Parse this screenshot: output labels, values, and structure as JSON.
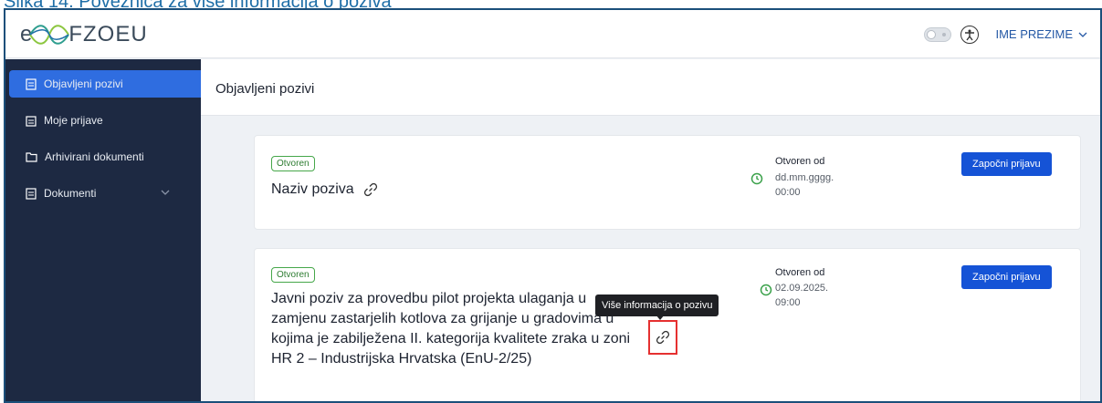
{
  "caption": "Slika 14. Poveznica za više informacija o poziva",
  "header": {
    "logo_prefix": "e",
    "logo_text": "FZOEU",
    "user_name": "IME PREZIME"
  },
  "sidebar": {
    "items": [
      {
        "label": "Objavljeni pozivi",
        "icon": "document-icon",
        "active": true
      },
      {
        "label": "Moje prijave",
        "icon": "clipboard-icon",
        "active": false
      },
      {
        "label": "Arhivirani dokumenti",
        "icon": "folder-icon",
        "active": false
      },
      {
        "label": "Dokumenti",
        "icon": "document-icon",
        "active": false
      }
    ]
  },
  "main": {
    "title": "Objavljeni pozivi",
    "cards": [
      {
        "status": "Otvoren",
        "title": "Naziv poziva",
        "open_label": "Otvoren od",
        "open_date": "dd.mm.gggg.",
        "open_time": "00:00",
        "button": "Započni prijavu"
      },
      {
        "status": "Otvoren",
        "title_lines": [
          "Javni poziv za provedbu pilot projekta ulaganja u",
          "zamjenu zastarjelih kotlova za grijanje u gradovima u",
          "kojima je zabilježena II. kategorija kvalitete zraka u zoni",
          "HR 2 – Industrijska Hrvatska (EnU-2/25)"
        ],
        "open_label": "Otvoren od",
        "open_date": "02.09.2025.",
        "open_time": "09:00",
        "button": "Započni prijavu"
      }
    ]
  },
  "tooltip": "Više informacija o pozivu",
  "colors": {
    "sidebar_bg": "#1d2942",
    "active_item": "#2f6de0",
    "primary_button": "#1553d6",
    "badge_green": "#46a74a",
    "highlight_red": "#e53030"
  }
}
